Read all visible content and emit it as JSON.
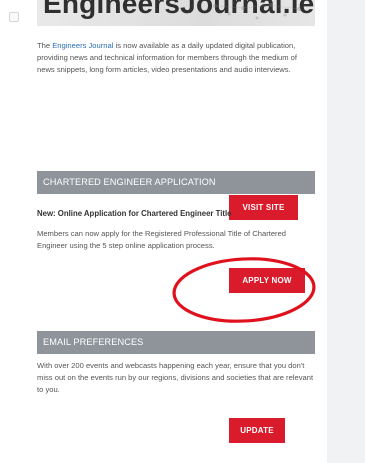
{
  "banner": {
    "title": "EngineersJournal.ie"
  },
  "intro": {
    "link_text": "Engineers Journal",
    "text_before": "The ",
    "text_after": " is now available as a daily updated digital publication, providing news and technical information for members through the medium of news snippets, long form articles, video presentations and audio interviews."
  },
  "buttons": {
    "visit_site": "VISIT SITE",
    "apply_now": "APPLY NOW",
    "update": "UPDATE"
  },
  "chartered": {
    "header": "CHARTERED ENGINEER APPLICATION",
    "subheading": "New: Online Application for Chartered Engineer Title",
    "body": "Members can now apply for the Registered Professional Title of Chartered Engineer using the 5 step online application process."
  },
  "email": {
    "header": "EMAIL PREFERENCES",
    "body": "With over 200 events and webcasts happening each year, ensure that you don't miss out on the events run by our regions, divisions and societies that are relevant to you."
  },
  "colors": {
    "button_red": "#d91b2b",
    "header_gray": "#8e949a",
    "link_blue": "#2a6fb5",
    "annotation_red": "#e0111c"
  }
}
